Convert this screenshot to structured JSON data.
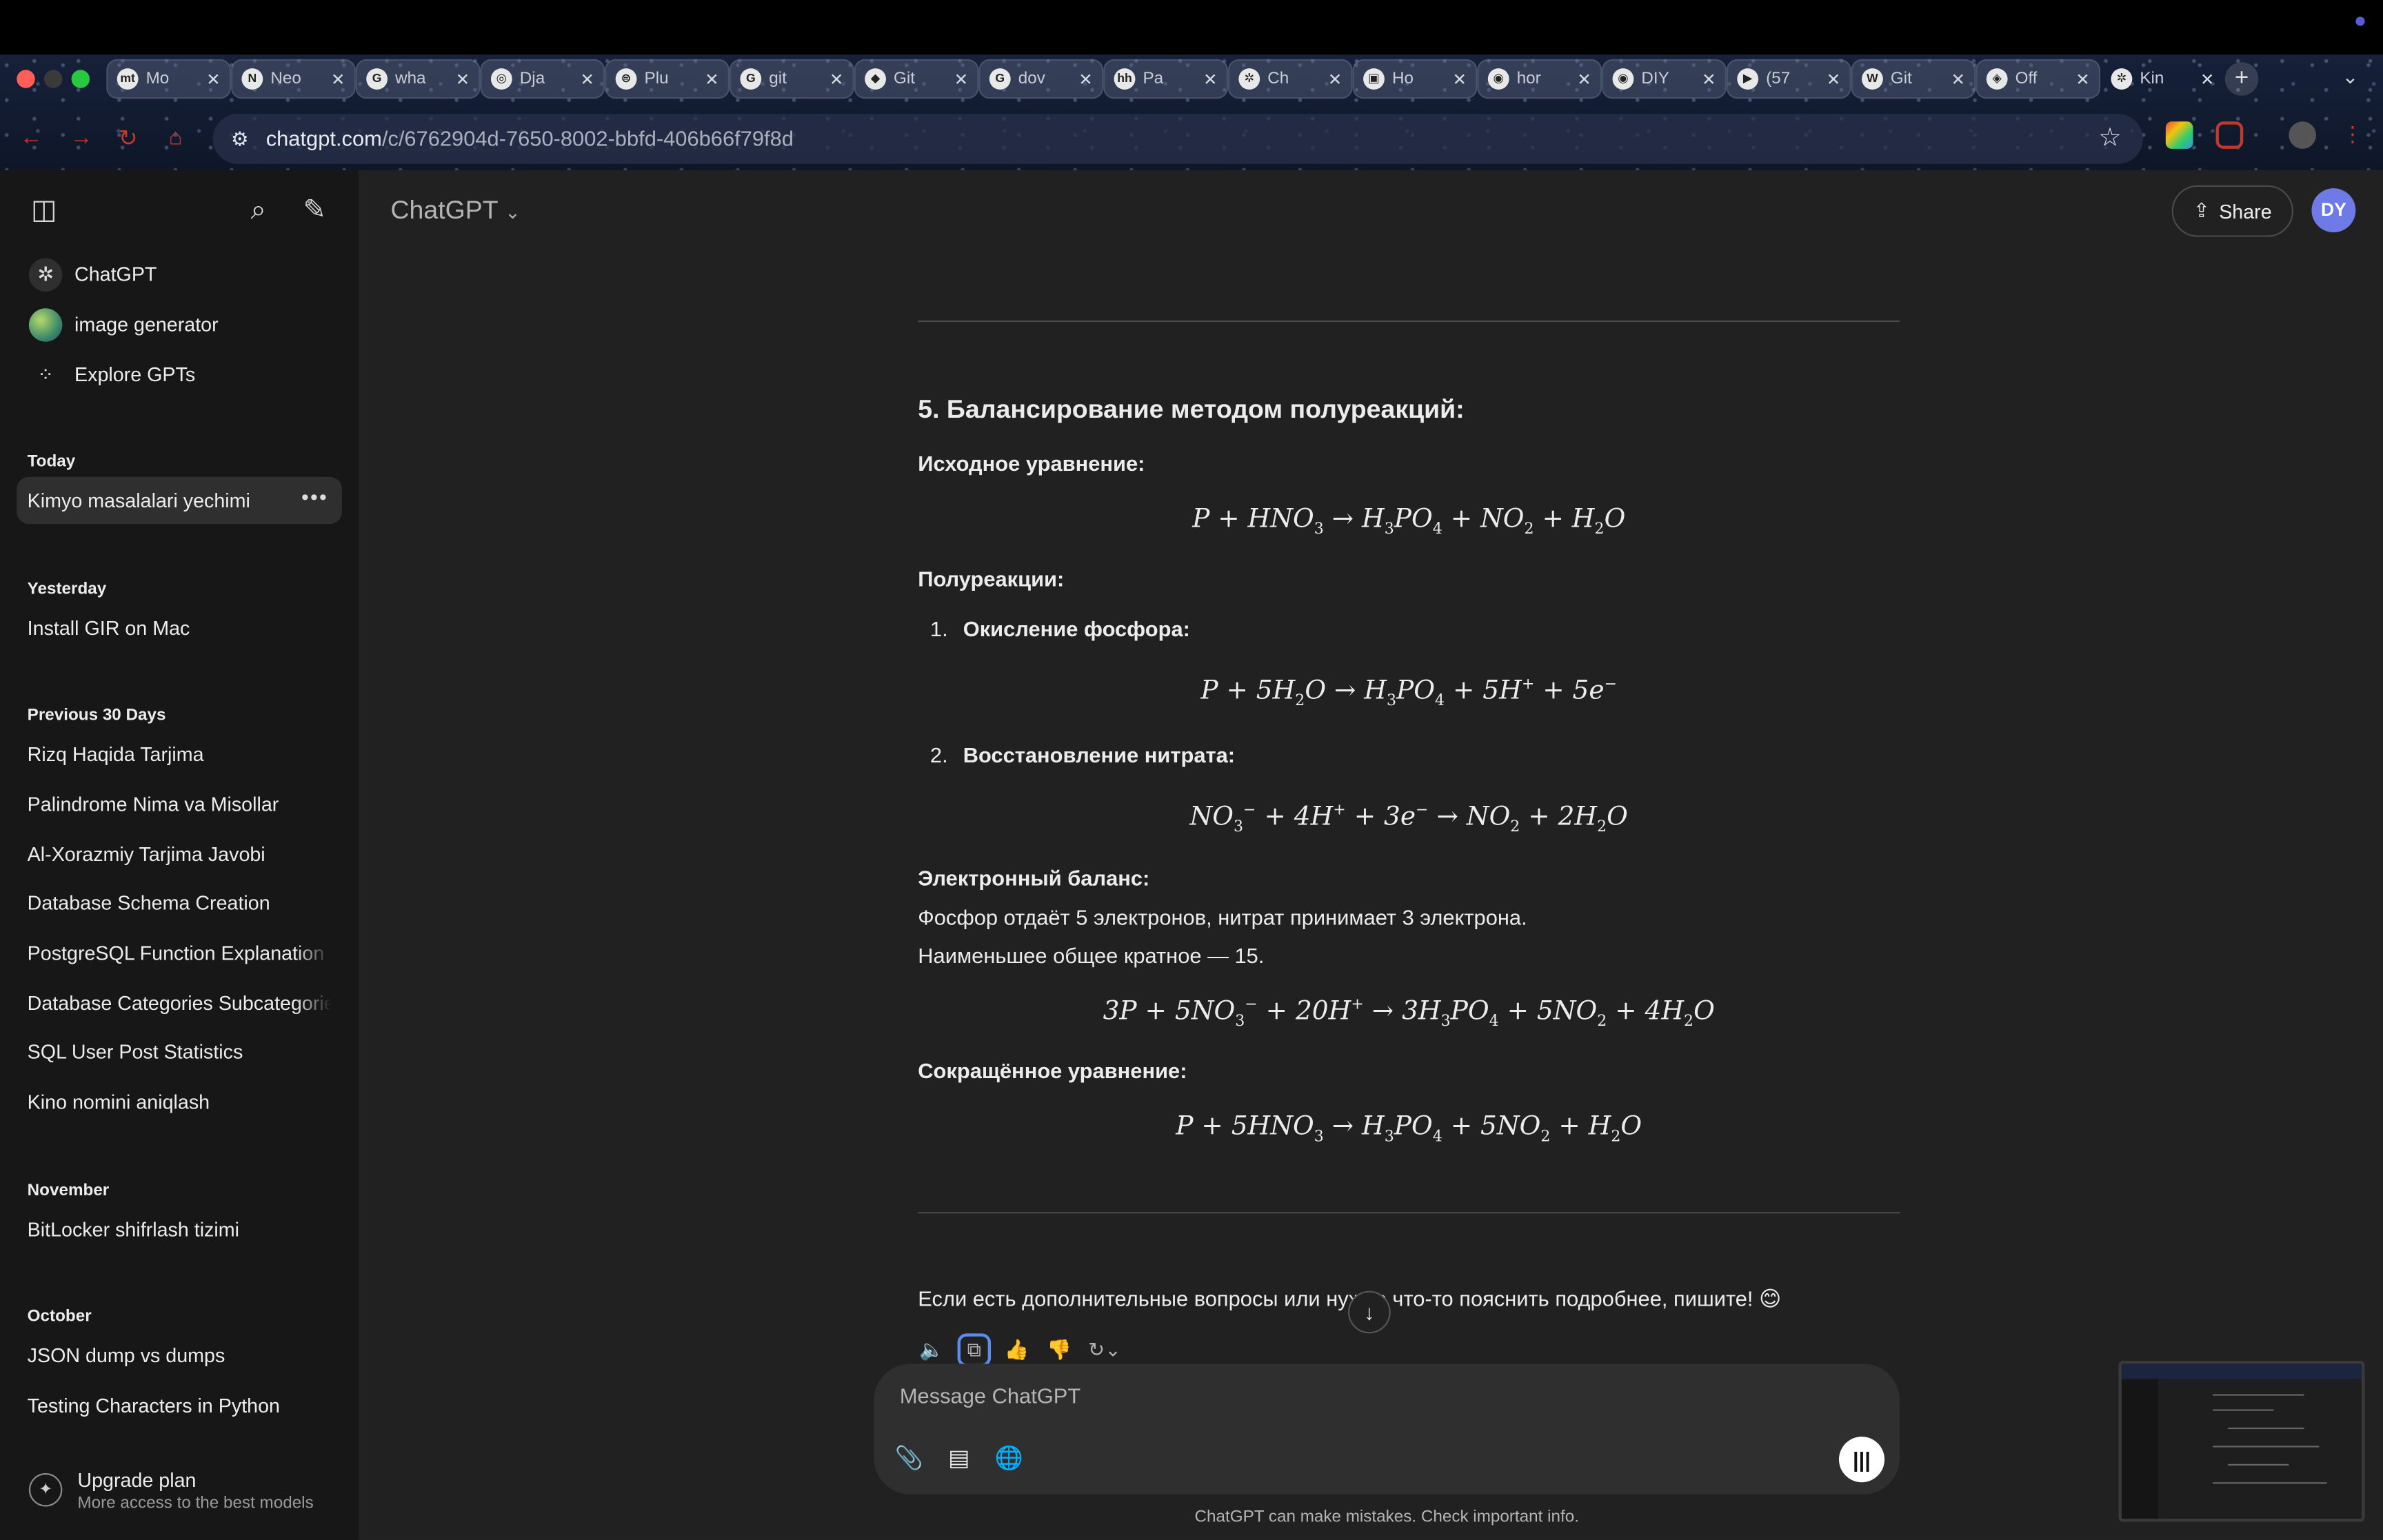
{
  "browser": {
    "tabs": [
      {
        "title": "Mo",
        "fav": "mt"
      },
      {
        "title": "Neo",
        "fav": "N"
      },
      {
        "title": "wha",
        "fav": "G"
      },
      {
        "title": "Dja",
        "fav": "◎"
      },
      {
        "title": "Plu",
        "fav": "⊜"
      },
      {
        "title": "git",
        "fav": "G"
      },
      {
        "title": "Git",
        "fav": "◆"
      },
      {
        "title": "dov",
        "fav": "G"
      },
      {
        "title": "Pa",
        "fav": "hh"
      },
      {
        "title": "Ch",
        "fav": "✲"
      },
      {
        "title": "Ho",
        "fav": "▣"
      },
      {
        "title": "hor",
        "fav": "◉"
      },
      {
        "title": "DIY",
        "fav": "◉"
      },
      {
        "title": "(57",
        "fav": "▶"
      },
      {
        "title": "Git",
        "fav": "W"
      },
      {
        "title": "Off",
        "fav": "◈"
      },
      {
        "title": "Kin",
        "fav": "✲"
      }
    ],
    "url_host": "chatgpt.com",
    "url_path": "/c/6762904d-7650-8002-bbfd-406b66f79f8d"
  },
  "sidebar": {
    "nav": [
      {
        "label": "ChatGPT"
      },
      {
        "label": "image generator"
      },
      {
        "label": "Explore GPTs"
      }
    ],
    "sections": [
      {
        "title": "Today",
        "items": [
          "Kimyo masalalari yechimi"
        ]
      },
      {
        "title": "Yesterday",
        "items": [
          "Install GIR on Mac"
        ]
      },
      {
        "title": "Previous 30 Days",
        "items": [
          "Rizq Haqida Tarjima",
          "Palindrome Nima va Misollar",
          "Al-Xorazmiy Tarjima Javobi",
          "Database Schema Creation",
          "PostgreSQL Function Explanation",
          "Database Categories Subcategories",
          "SQL User Post Statistics",
          "Kino nomini aniqlash"
        ]
      },
      {
        "title": "November",
        "items": [
          "BitLocker shifrlash tizimi"
        ]
      },
      {
        "title": "October",
        "items": [
          "JSON dump vs dumps",
          "Testing Characters in Python"
        ]
      }
    ],
    "upgrade_title": "Upgrade plan",
    "upgrade_sub": "More access to the best models"
  },
  "header": {
    "model": "ChatGPT",
    "share": "Share",
    "avatar": "DY"
  },
  "message": {
    "heading": "5. Балансирование методом полуреакций:",
    "source_label": "Исходное уравнение:",
    "half_label": "Полуреакции:",
    "step1_num": "1.",
    "step1_label": "Окисление фосфора:",
    "step2_num": "2.",
    "step2_label": "Восстановление нитрата:",
    "balance_label": "Электронный баланс:",
    "balance_line1": "Фосфор отдаёт 5 электронов, нитрат принимает 3 электрона.",
    "balance_line2": "Наименьшее общее кратное — 15.",
    "short_label": "Сокращённое уравнение:",
    "closing": "Если есть дополнительные вопросы или нужно что-то пояснить подробнее, пишите! 😊"
  },
  "composer": {
    "placeholder": "Message ChatGPT",
    "disclaimer": "ChatGPT can make mistakes. Check important info."
  }
}
